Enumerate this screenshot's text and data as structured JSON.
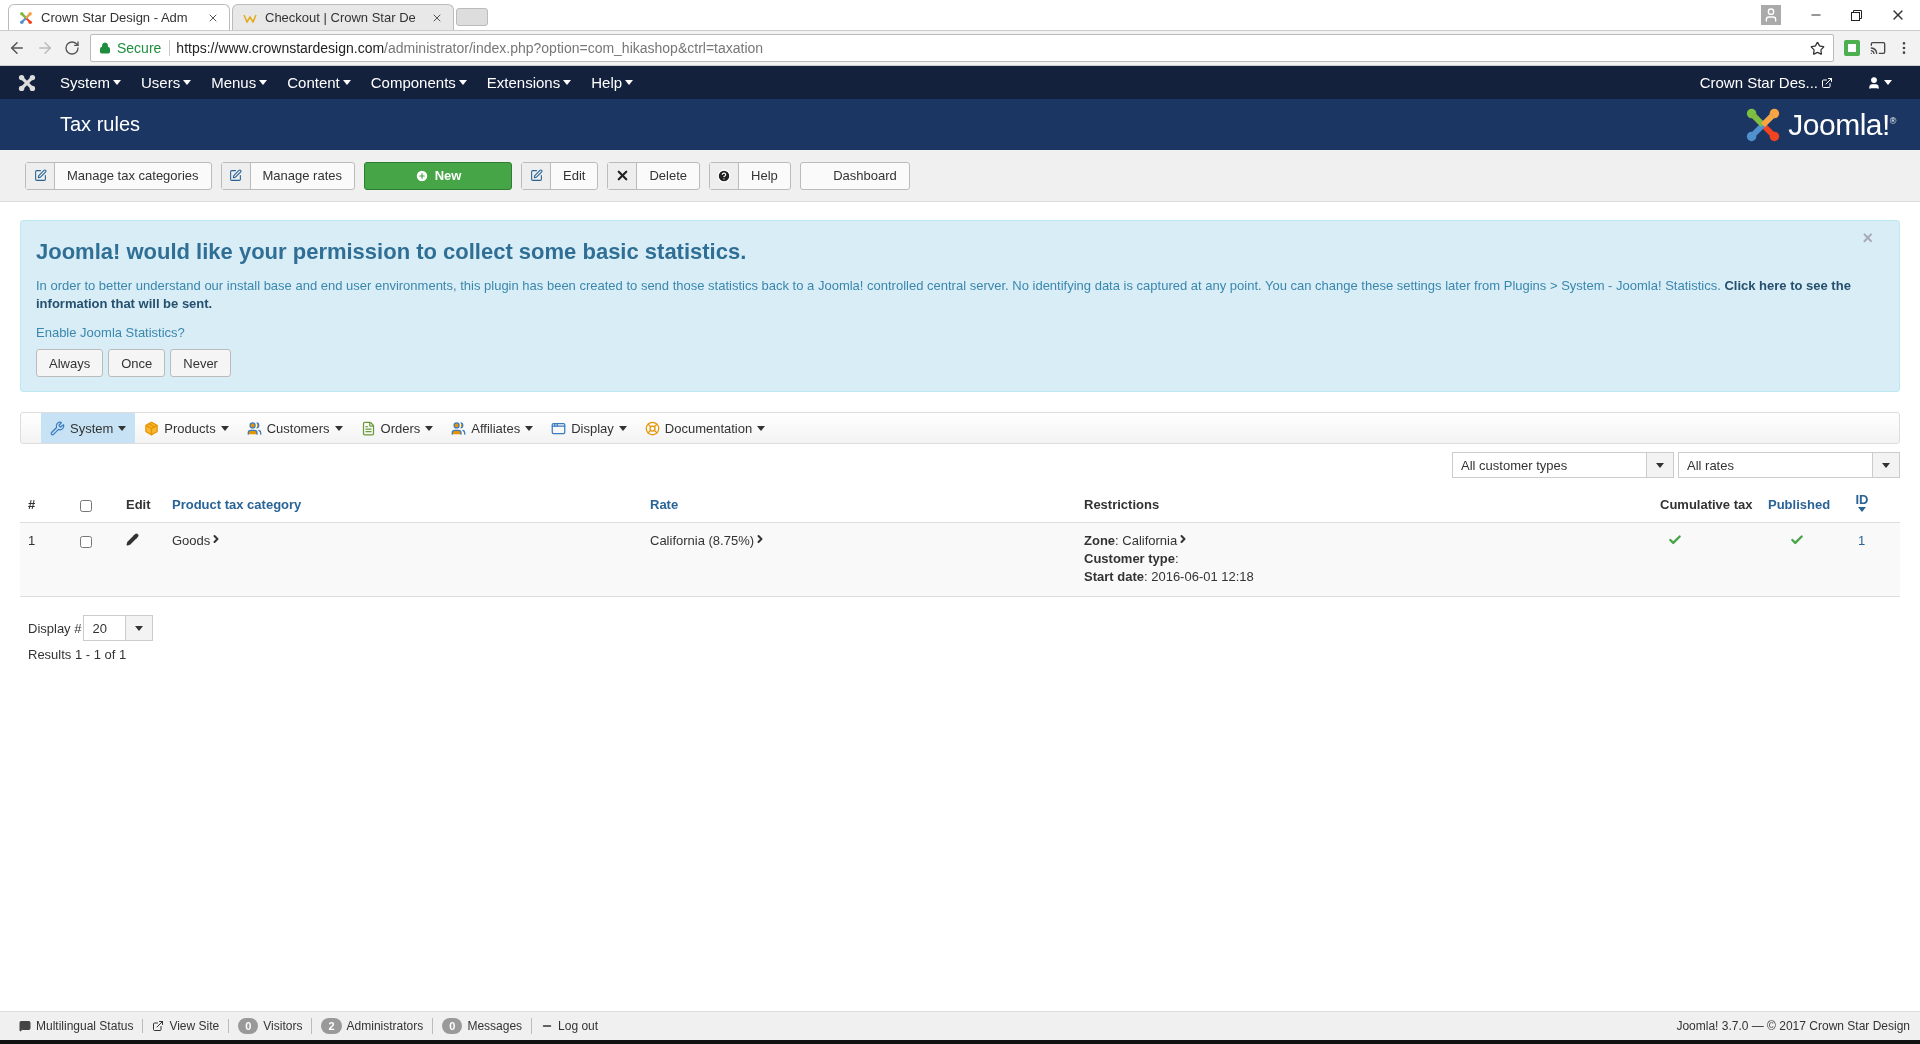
{
  "browser": {
    "tabs": [
      {
        "title": "Crown Star Design - Adm",
        "selected": true
      },
      {
        "title": "Checkout | Crown Star De",
        "selected": false
      }
    ],
    "secure_label": "Secure",
    "url_host": "https://www.crownstardesign.com",
    "url_path": "/administrator/index.php?option=com_hikashop&ctrl=taxation"
  },
  "nav": {
    "menus": [
      "System",
      "Users",
      "Menus",
      "Content",
      "Components",
      "Extensions",
      "Help"
    ],
    "site_link": "Crown Star Des..."
  },
  "header": {
    "title": "Tax rules",
    "brand": "Joomla!$^{®}$"
  },
  "toolbar": [
    {
      "label": "Manage tax categories",
      "kind": "edit"
    },
    {
      "label": "Manage rates",
      "kind": "edit"
    },
    {
      "label": "New",
      "kind": "primary"
    },
    {
      "label": "Edit",
      "kind": "edit"
    },
    {
      "label": "Delete",
      "kind": "delete"
    },
    {
      "label": "Help",
      "kind": "help"
    },
    {
      "label": "Dashboard",
      "kind": "plain"
    }
  ],
  "alert": {
    "title": "Joomla! would like your permission to collect some basic statistics.",
    "text": "In order to better understand our install base and end user environments, this plugin has been created to send those statistics back to a Joomla! controlled central server. No identifying data is captured at any point. You can change these settings later from Plugins > System - Joomla! Statistics. **Click here to see the information that will be sent.**",
    "question": "Enable Joomla Statistics?",
    "buttons": [
      "Always",
      "Once",
      "Never"
    ],
    "close": "×"
  },
  "submenu": [
    {
      "label": "System",
      "kind": "wrench",
      "selected": true
    },
    {
      "label": "Products",
      "kind": "box",
      "selected": false
    },
    {
      "label": "Customers",
      "kind": "people",
      "selected": false
    },
    {
      "label": "Orders",
      "kind": "document",
      "selected": false
    },
    {
      "label": "Affiliates",
      "kind": "people",
      "selected": false
    },
    {
      "label": "Display",
      "kind": "window",
      "selected": false
    },
    {
      "label": "Documentation",
      "kind": "lifebuoy",
      "selected": false
    }
  ],
  "filters": [
    "All customer types",
    "All rates"
  ],
  "table": {
    "columns": [
      {
        "label": "#",
        "kind": "plain"
      },
      {
        "kind": "checkbox",
        "checked": false
      },
      {
        "label": "Edit",
        "kind": "plain"
      },
      {
        "label": "Product tax category",
        "kind": "link"
      },
      {
        "label": "Rate",
        "kind": "link"
      },
      {
        "label": "Restrictions",
        "kind": "plain"
      },
      {
        "label": "Cumulative tax",
        "kind": "plain"
      },
      {
        "label": "Published",
        "kind": "link"
      },
      {
        "label": "ID",
        "kind": "sort"
      }
    ],
    "rows": [
      {
        "number": "1",
        "checked": false,
        "category": "Goods",
        "rate": "California (8.75%)",
        "restrictions": [
          {
            "text": "**Zone**: California",
            "link": true
          },
          {
            "text": "**Customer type**:",
            "link": false
          },
          {
            "text": "**Start date**: 2016-06-01 12:18",
            "link": false
          }
        ],
        "cumulative": true,
        "published": true,
        "id": "1"
      }
    ]
  },
  "pagination": {
    "label": "Display #",
    "value": "20",
    "results": "Results 1 - 1 of 1"
  },
  "status_bar": {
    "items": [
      {
        "label": "Multilingual Status",
        "kind": "comment"
      },
      {
        "label": "View Site",
        "kind": "external"
      },
      {
        "label": "Visitors",
        "kind": "count",
        "count": "0"
      },
      {
        "label": "Administrators",
        "kind": "count",
        "count": "2"
      },
      {
        "label": "Messages",
        "kind": "count",
        "count": "0"
      },
      {
        "label": "Log out",
        "kind": "logout"
      }
    ],
    "version": "Joomla! 3.7.0  —  © 2017 Crown Star Design"
  }
}
